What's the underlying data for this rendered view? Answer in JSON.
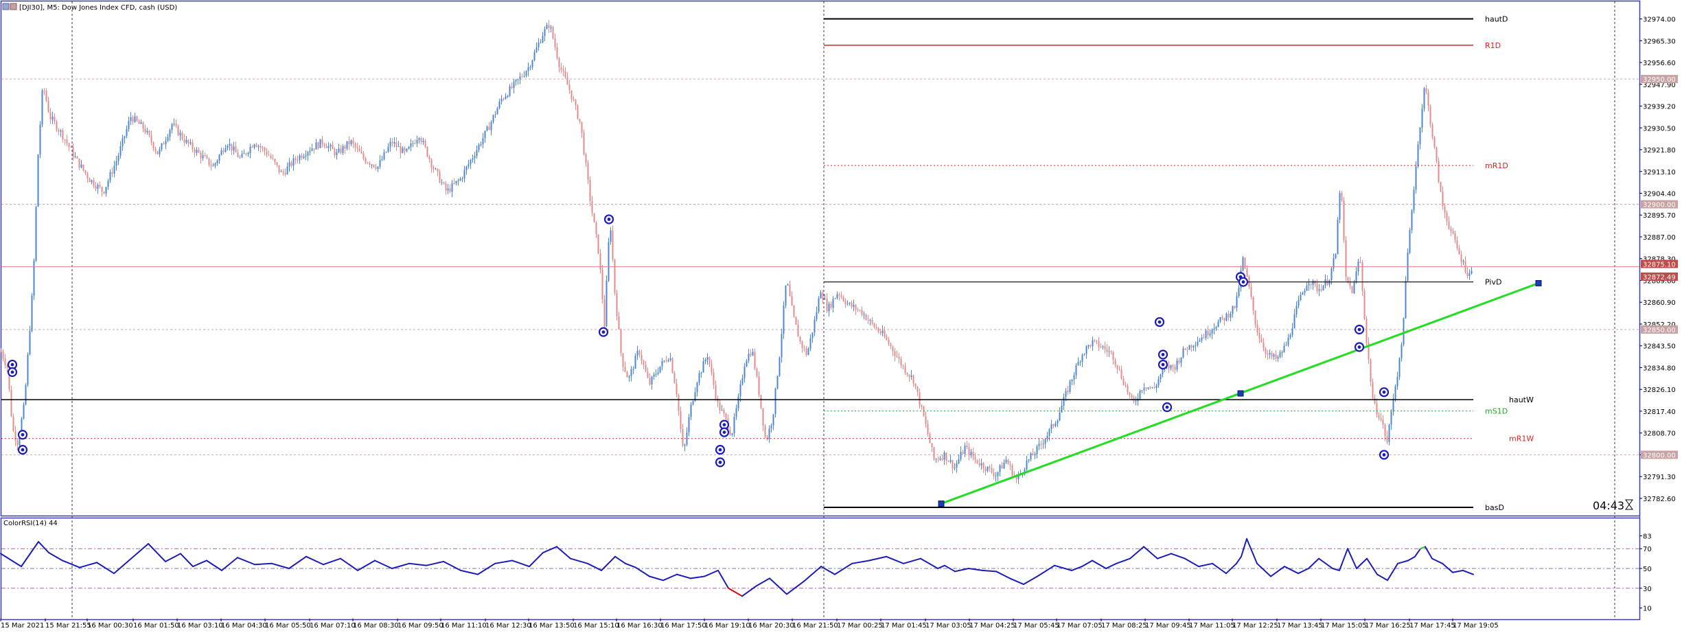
{
  "window": {
    "title": "[DJI30], M5: Dow Jones Index CFD, cash (USD)",
    "countdown": "04:43"
  },
  "colors": {
    "bull": "#4a86d6",
    "bear": "#e38b8b",
    "frame": "#3b3bb0",
    "trend": "#22dd22",
    "pivot_red": "#dd2222",
    "pivot_green": "#22aa22",
    "pivot_black": "#000000",
    "rsi_line": "#1c1cb8",
    "rsi_up": "#22cc22",
    "rsi_down": "#dd0000",
    "marker": "#1c1cb8"
  },
  "chart_data": [
    {
      "type": "candlestick",
      "symbol": "DJI30",
      "timeframe": "M5",
      "ylim": [
        32776,
        32981
      ],
      "price_ticks": [
        "32974.00",
        "32965.30",
        "32956.60",
        "32947.90",
        "32939.20",
        "32930.50",
        "32921.80",
        "32913.10",
        "32904.40",
        "32895.70",
        "32887.00",
        "32878.30",
        "32869.60",
        "32860.90",
        "32852.20",
        "32843.50",
        "32834.80",
        "32826.10",
        "32817.40",
        "32808.70",
        "32800.00",
        "32791.30",
        "32782.60"
      ],
      "price_badges": [
        {
          "label": "32950.00",
          "price": 32950.0
        },
        {
          "label": "32900.00",
          "price": 32900.0
        },
        {
          "label": "32875.10",
          "price": 32875.1
        },
        {
          "label": "32872.49",
          "price": 32872.49
        },
        {
          "label": "32850.00",
          "price": 32850.0
        },
        {
          "label": "32800.00",
          "price": 32800.0
        }
      ],
      "time_labels": [
        "15 Mar 2021",
        "15 Mar 21:55",
        "16 Mar 00:30",
        "16 Mar 01:50",
        "16 Mar 03:10",
        "16 Mar 04:30",
        "16 Mar 05:50",
        "16 Mar 07:10",
        "16 Mar 08:30",
        "16 Mar 09:50",
        "16 Mar 11:10",
        "16 Mar 12:30",
        "16 Mar 13:50",
        "16 Mar 15:10",
        "16 Mar 16:30",
        "16 Mar 17:50",
        "16 Mar 19:10",
        "16 Mar 20:30",
        "16 Mar 21:50",
        "17 Mar 00:25",
        "17 Mar 01:45",
        "17 Mar 03:05",
        "17 Mar 04:25",
        "17 Mar 05:45",
        "17 Mar 07:05",
        "17 Mar 08:25",
        "17 Mar 09:45",
        "17 Mar 11:05",
        "17 Mar 12:25",
        "17 Mar 13:45",
        "17 Mar 15:05",
        "17 Mar 16:25",
        "17 Mar 17:45",
        "17 Mar 19:05"
      ],
      "price_path": [
        [
          0,
          32842
        ],
        [
          10,
          32835
        ],
        [
          18,
          32810
        ],
        [
          25,
          32805
        ],
        [
          35,
          32820
        ],
        [
          48,
          32870
        ],
        [
          55,
          32920
        ],
        [
          62,
          32948
        ],
        [
          72,
          32935
        ],
        [
          90,
          32928
        ],
        [
          110,
          32918
        ],
        [
          130,
          32910
        ],
        [
          150,
          32905
        ],
        [
          170,
          32918
        ],
        [
          190,
          32935
        ],
        [
          210,
          32930
        ],
        [
          230,
          32920
        ],
        [
          250,
          32932
        ],
        [
          270,
          32925
        ],
        [
          290,
          32920
        ],
        [
          310,
          32915
        ],
        [
          330,
          32925
        ],
        [
          350,
          32918
        ],
        [
          370,
          32925
        ],
        [
          390,
          32920
        ],
        [
          410,
          32912
        ],
        [
          430,
          32918
        ],
        [
          450,
          32922
        ],
        [
          470,
          32925
        ],
        [
          490,
          32920
        ],
        [
          510,
          32925
        ],
        [
          530,
          32918
        ],
        [
          550,
          32915
        ],
        [
          570,
          32925
        ],
        [
          590,
          32920
        ],
        [
          610,
          32928
        ],
        [
          630,
          32915
        ],
        [
          650,
          32905
        ],
        [
          670,
          32910
        ],
        [
          690,
          32920
        ],
        [
          710,
          32930
        ],
        [
          730,
          32942
        ],
        [
          750,
          32948
        ],
        [
          770,
          32955
        ],
        [
          790,
          32968
        ],
        [
          800,
          32972
        ],
        [
          815,
          32955
        ],
        [
          830,
          32945
        ],
        [
          845,
          32932
        ],
        [
          860,
          32900
        ],
        [
          872,
          32880
        ],
        [
          880,
          32852
        ],
        [
          888,
          32895
        ],
        [
          895,
          32865
        ],
        [
          905,
          32838
        ],
        [
          915,
          32830
        ],
        [
          930,
          32842
        ],
        [
          945,
          32828
        ],
        [
          960,
          32835
        ],
        [
          975,
          32840
        ],
        [
          985,
          32825
        ],
        [
          995,
          32800
        ],
        [
          1005,
          32818
        ],
        [
          1015,
          32830
        ],
        [
          1030,
          32840
        ],
        [
          1045,
          32820
        ],
        [
          1055,
          32815
        ],
        [
          1065,
          32808
        ],
        [
          1075,
          32822
        ],
        [
          1085,
          32838
        ],
        [
          1095,
          32842
        ],
        [
          1105,
          32825
        ],
        [
          1115,
          32805
        ],
        [
          1125,
          32815
        ],
        [
          1135,
          32840
        ],
        [
          1145,
          32870
        ],
        [
          1155,
          32855
        ],
        [
          1165,
          32845
        ],
        [
          1175,
          32840
        ],
        [
          1185,
          32852
        ],
        [
          1195,
          32866
        ],
        [
          1205,
          32858
        ],
        [
          1220,
          32865
        ],
        [
          1235,
          32860
        ],
        [
          1255,
          32857
        ],
        [
          1270,
          32852
        ],
        [
          1285,
          32848
        ],
        [
          1300,
          32842
        ],
        [
          1315,
          32835
        ],
        [
          1330,
          32830
        ],
        [
          1345,
          32815
        ],
        [
          1360,
          32798
        ],
        [
          1375,
          32800
        ],
        [
          1390,
          32795
        ],
        [
          1405,
          32803
        ],
        [
          1420,
          32798
        ],
        [
          1435,
          32795
        ],
        [
          1450,
          32792
        ],
        [
          1465,
          32798
        ],
        [
          1480,
          32790
        ],
        [
          1495,
          32797
        ],
        [
          1510,
          32802
        ],
        [
          1525,
          32808
        ],
        [
          1540,
          32815
        ],
        [
          1560,
          32830
        ],
        [
          1575,
          32840
        ],
        [
          1590,
          32845
        ],
        [
          1605,
          32843
        ],
        [
          1620,
          32840
        ],
        [
          1635,
          32830
        ],
        [
          1650,
          32820
        ],
        [
          1665,
          32828
        ],
        [
          1680,
          32826
        ],
        [
          1695,
          32835
        ],
        [
          1710,
          32835
        ],
        [
          1725,
          32842
        ],
        [
          1740,
          32845
        ],
        [
          1755,
          32848
        ],
        [
          1770,
          32852
        ],
        [
          1785,
          32855
        ],
        [
          1800,
          32860
        ],
        [
          1810,
          32878
        ],
        [
          1820,
          32865
        ],
        [
          1830,
          32850
        ],
        [
          1845,
          32840
        ],
        [
          1860,
          32838
        ],
        [
          1875,
          32845
        ],
        [
          1890,
          32860
        ],
        [
          1905,
          32870
        ],
        [
          1920,
          32866
        ],
        [
          1935,
          32870
        ],
        [
          1945,
          32880
        ],
        [
          1952,
          32910
        ],
        [
          1960,
          32870
        ],
        [
          1970,
          32865
        ],
        [
          1980,
          32880
        ],
        [
          1990,
          32845
        ],
        [
          2000,
          32820
        ],
        [
          2010,
          32815
        ],
        [
          2020,
          32805
        ],
        [
          2030,
          32825
        ],
        [
          2040,
          32840
        ],
        [
          2050,
          32880
        ],
        [
          2060,
          32910
        ],
        [
          2068,
          32932
        ],
        [
          2075,
          32948
        ],
        [
          2082,
          32935
        ],
        [
          2090,
          32920
        ],
        [
          2100,
          32900
        ],
        [
          2112,
          32890
        ],
        [
          2125,
          32880
        ],
        [
          2138,
          32872
        ],
        [
          2145,
          32873
        ]
      ],
      "series": [
        {
          "name": "hautD",
          "value": 32974.0
        },
        {
          "name": "R1D",
          "value": 32963.5
        },
        {
          "name": "mR1D",
          "value": 32915.5
        },
        {
          "name": "PivD",
          "value": 32869.0
        },
        {
          "name": "hautW",
          "value": 32822.0
        },
        {
          "name": "mS1D",
          "value": 32817.5
        },
        {
          "name": "mR1W",
          "value": 32806.5
        },
        {
          "name": "basD",
          "value": 32779.0
        }
      ],
      "trendline": [
        [
          1371,
          32780.5
        ],
        [
          1807,
          32824.5
        ],
        [
          2241,
          32868.5
        ]
      ],
      "markers": [
        [
          18,
          32836
        ],
        [
          18,
          32833
        ],
        [
          33,
          32808
        ],
        [
          33,
          32802
        ],
        [
          887,
          32894
        ],
        [
          879,
          32849
        ],
        [
          1055,
          32812
        ],
        [
          1055,
          32809
        ],
        [
          1049,
          32802
        ],
        [
          1049,
          32797
        ],
        [
          1689,
          32853
        ],
        [
          1694,
          32840
        ],
        [
          1694,
          32836
        ],
        [
          1700,
          32819
        ],
        [
          1807,
          32871
        ],
        [
          1811,
          32869
        ],
        [
          1980,
          32850
        ],
        [
          1980,
          32843
        ],
        [
          2016,
          32825
        ],
        [
          2016,
          32800
        ]
      ]
    },
    {
      "type": "line",
      "title": "ColorRSI(14) 44",
      "ylim": [
        0,
        100
      ],
      "yticks": [
        83,
        70,
        50,
        30,
        10
      ],
      "levels": [
        70,
        50,
        30
      ],
      "x": [
        0,
        30,
        55,
        70,
        90,
        115,
        140,
        165,
        190,
        215,
        240,
        262,
        280,
        300,
        322,
        345,
        370,
        395,
        420,
        445,
        470,
        495,
        520,
        545,
        570,
        595,
        620,
        645,
        670,
        695,
        720,
        745,
        770,
        790,
        810,
        830,
        855,
        875,
        885,
        895,
        910,
        925,
        945,
        965,
        985,
        1005,
        1025,
        1045,
        1060,
        1080,
        1100,
        1120,
        1145,
        1170,
        1195,
        1215,
        1240,
        1265,
        1290,
        1315,
        1340,
        1365,
        1375,
        1390,
        1410,
        1430,
        1450,
        1470,
        1490,
        1510,
        1535,
        1560,
        1575,
        1590,
        1610,
        1625,
        1645,
        1665,
        1685,
        1705,
        1725,
        1745,
        1765,
        1785,
        1800,
        1807,
        1815,
        1830,
        1850,
        1870,
        1890,
        1905,
        1920,
        1940,
        1950,
        1962,
        1975,
        1990,
        2005,
        2020,
        2035,
        2050,
        2060,
        2068,
        2075,
        2085,
        2100,
        2115,
        2130,
        2145
      ],
      "values": [
        65,
        52,
        77,
        66,
        58,
        51,
        56,
        45,
        60,
        75,
        57,
        65,
        52,
        58,
        48,
        61,
        54,
        55,
        50,
        62,
        54,
        60,
        48,
        58,
        50,
        55,
        53,
        57,
        48,
        44,
        55,
        58,
        52,
        66,
        72,
        60,
        55,
        48,
        55,
        62,
        55,
        51,
        42,
        38,
        44,
        40,
        42,
        48,
        30,
        22,
        32,
        40,
        24,
        37,
        52,
        44,
        55,
        58,
        62,
        55,
        60,
        50,
        53,
        47,
        50,
        48,
        47,
        40,
        34,
        42,
        53,
        48,
        52,
        58,
        50,
        55,
        60,
        72,
        60,
        65,
        60,
        52,
        55,
        45,
        55,
        62,
        80,
        55,
        42,
        52,
        45,
        50,
        60,
        50,
        48,
        70,
        50,
        60,
        44,
        38,
        55,
        58,
        62,
        70,
        72,
        60,
        55,
        46,
        48,
        44
      ]
    }
  ]
}
